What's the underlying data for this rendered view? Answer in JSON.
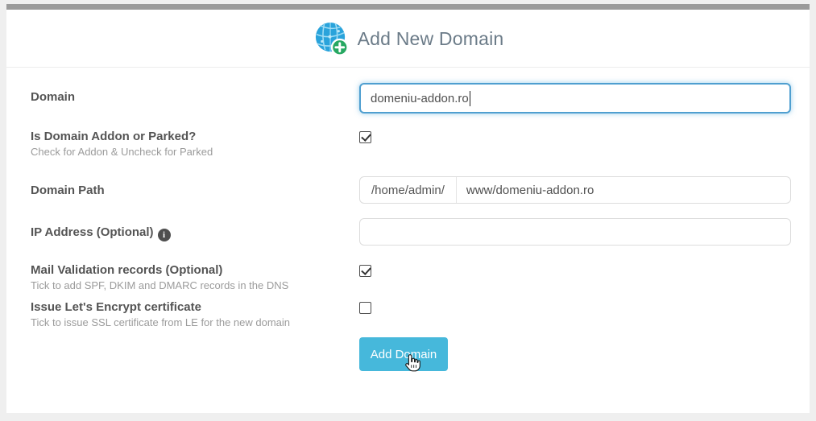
{
  "colors": {
    "accent_button": "#46b8db",
    "top_strip": "#9a9a9a",
    "focus_border": "#4f9fd0",
    "globe_blue": "#29a3db",
    "plus_green": "#27a862",
    "page_background": "#efefef"
  },
  "header": {
    "title": "Add New Domain",
    "icon": "globe-add-icon"
  },
  "form": {
    "domain": {
      "label": "Domain",
      "value": "domeniu-addon.ro"
    },
    "addon_parked": {
      "label": "Is Domain Addon or Parked?",
      "helper": "Check for Addon & Uncheck for Parked",
      "checked": true
    },
    "domain_path": {
      "label": "Domain Path",
      "prefix": "/home/admin/",
      "value": "www/domeniu-addon.ro"
    },
    "ip_address": {
      "label": "IP Address (Optional)",
      "value": "",
      "info_glyph": "i"
    },
    "mail_validation": {
      "label": "Mail Validation records (Optional)",
      "helper": "Tick to add SPF, DKIM and DMARC records in the DNS",
      "checked": true
    },
    "lets_encrypt": {
      "label": "Issue Let's Encrypt certificate",
      "helper": "Tick to issue SSL certificate from LE for the new domain",
      "checked": false
    },
    "submit_label": "Add Domain"
  }
}
